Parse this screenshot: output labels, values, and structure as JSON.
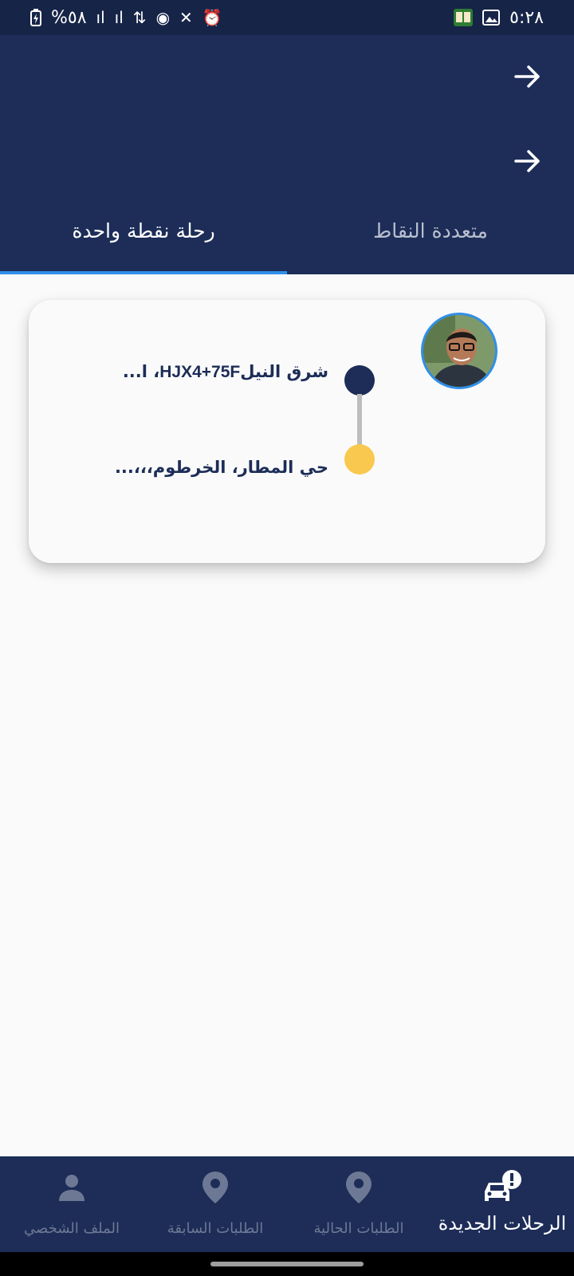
{
  "status_bar": {
    "time": "٥:٢٨",
    "battery": "%٥٨",
    "left_icons": [
      "battery-icon",
      "signal-icon",
      "signal-icon",
      "data-arrows-icon",
      "hotspot-icon",
      "mute-icon",
      "alarm-icon"
    ],
    "right_icons": [
      "book-app-icon",
      "image-icon"
    ]
  },
  "header": {
    "arrow_icons": [
      "arrow-right-icon",
      "arrow-right-icon"
    ]
  },
  "tabs": [
    {
      "label": "رحلة نقطة واحدة",
      "active": true
    },
    {
      "label": "متعددة النقاط",
      "active": false
    }
  ],
  "trip_card": {
    "pickup_address_prefix": "شرق النيل",
    "pickup_address_code": "HJX4+75F",
    "pickup_address_suffix": "، ا...",
    "dropoff_address": "حي المطار، الخرطوم،،،..."
  },
  "bottom_nav": [
    {
      "label": "الرحلات الجديدة",
      "icon": "car-alert-icon",
      "active": true
    },
    {
      "label": "الطلبات الحالية",
      "icon": "location-pin-icon",
      "active": false
    },
    {
      "label": "الطلبات السابقة",
      "icon": "location-pin-icon",
      "active": false
    },
    {
      "label": "الملف الشخصي",
      "icon": "person-icon",
      "active": false
    }
  ],
  "colors": {
    "primary": "#1d2d58",
    "accent": "#2f8fe8",
    "pickup_dot": "#1d2d58",
    "dropoff_dot": "#f8c94e"
  }
}
